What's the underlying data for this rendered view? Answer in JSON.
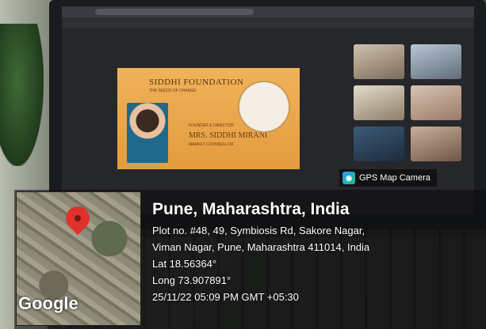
{
  "stamp": {
    "app_name": "GPS Map Camera",
    "location_title": "Pune, Maharashtra, India",
    "address_line1": "Plot no. #48, 49, Symbiosis Rd, Sakore Nagar,",
    "address_line2": "Viman Nagar, Pune, Maharashtra 411014, India",
    "latitude": "Lat 18.56364°",
    "longitude": "Long 73.907891°",
    "datetime": "25/11/22 05:09 PM GMT +05:30",
    "map_brand": "Google"
  },
  "slide": {
    "title": "SIDDHI FOUNDATION",
    "subtitle": "THE SEEDS OF CHANGE",
    "role": "FOUNDER & DIRECTOR",
    "name": "MRS. SIDDHI MIRANI",
    "designation": "MARKET COUNSELLOR"
  },
  "colors": {
    "pin": "#e0312d",
    "slide_bg": "#e9a448",
    "app_logo": "#2f9bff"
  }
}
